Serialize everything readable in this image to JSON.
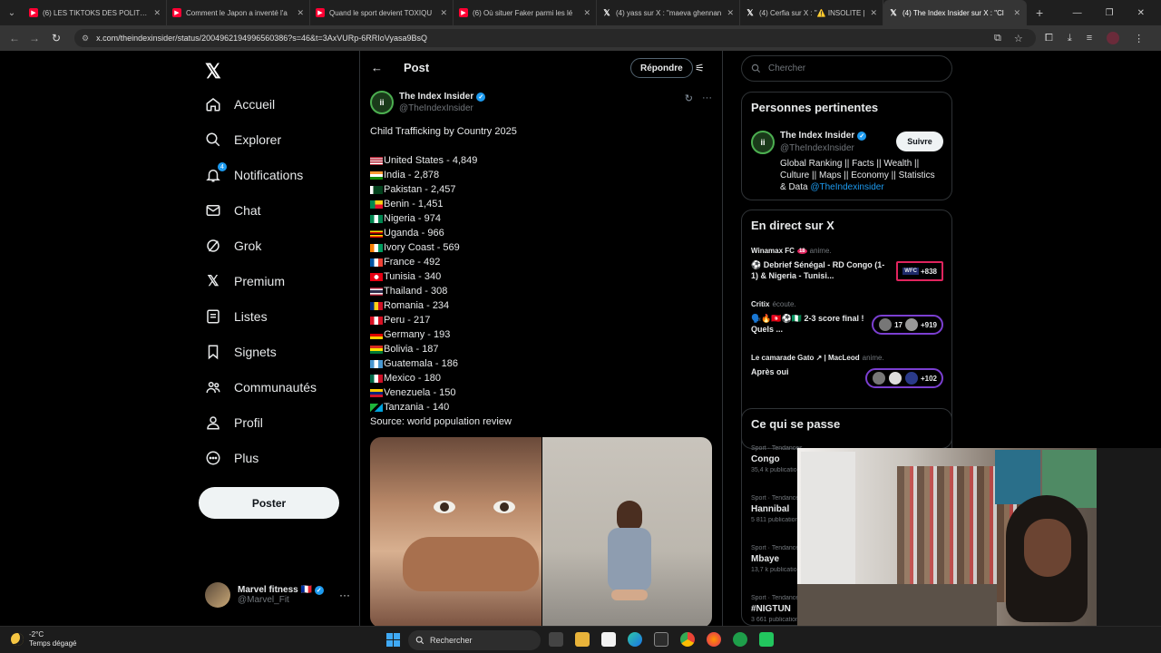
{
  "browser": {
    "tabs": [
      {
        "title": "(6) LES TIKTOKS DES POLITIQUES",
        "icon": "youtube-icon",
        "active": false
      },
      {
        "title": "Comment le Japon a inventé l'a",
        "icon": "youtube-icon",
        "active": false
      },
      {
        "title": "Quand le sport devient TOXIQU",
        "icon": "youtube-icon",
        "active": false
      },
      {
        "title": "(6) Où situer Faker parmi les lé",
        "icon": "youtube-icon",
        "active": false
      },
      {
        "title": "(4) yass sur X : \"maeva ghennan",
        "icon": "x-icon",
        "active": false
      },
      {
        "title": "(4) Cerfia sur X : \"⚠️ INSOLITE |",
        "icon": "x-icon",
        "active": false
      },
      {
        "title": "(4) The Index Insider sur X : \"Cl",
        "icon": "x-icon",
        "active": true
      }
    ],
    "url": "x.com/theindexinsider/status/2004962194996560386?s=46&t=3AxVURp-6RRIoVyasa9BsQ"
  },
  "nav": {
    "items": [
      {
        "label": "Accueil",
        "icon": "home-icon"
      },
      {
        "label": "Explorer",
        "icon": "search-icon"
      },
      {
        "label": "Notifications",
        "icon": "bell-icon",
        "badge": "4"
      },
      {
        "label": "Chat",
        "icon": "mail-icon"
      },
      {
        "label": "Grok",
        "icon": "grok-icon"
      },
      {
        "label": "Premium",
        "icon": "x-premium-icon"
      },
      {
        "label": "Listes",
        "icon": "list-icon"
      },
      {
        "label": "Signets",
        "icon": "bookmark-icon"
      },
      {
        "label": "Communautés",
        "icon": "people-icon"
      },
      {
        "label": "Profil",
        "icon": "person-icon"
      },
      {
        "label": "Plus",
        "icon": "more-circle-icon"
      }
    ],
    "post_button": "Poster",
    "account": {
      "name": "Marvel fitness",
      "handle": "@Marvel_Fit",
      "flag": "🇫🇷"
    }
  },
  "header": {
    "title": "Post",
    "reply_button": "Répondre"
  },
  "tweet": {
    "author_name": "The Index Insider",
    "author_handle": "@TheIndexInsider",
    "title": "Child Trafficking by Country 2025",
    "rows": [
      {
        "country": "United States",
        "value": "4,849",
        "flag": "us"
      },
      {
        "country": "India",
        "value": "2,878",
        "flag": "in"
      },
      {
        "country": "Pakistan",
        "value": "2,457",
        "flag": "pk"
      },
      {
        "country": "Benin",
        "value": "1,451",
        "flag": "bj"
      },
      {
        "country": "Nigeria",
        "value": "974",
        "flag": "ng"
      },
      {
        "country": "Uganda",
        "value": "966",
        "flag": "ug"
      },
      {
        "country": "Ivory Coast",
        "value": "569",
        "flag": "ci"
      },
      {
        "country": "France",
        "value": "492",
        "flag": "fr"
      },
      {
        "country": "Tunisia",
        "value": "340",
        "flag": "tn"
      },
      {
        "country": "Thailand",
        "value": "308",
        "flag": "th"
      },
      {
        "country": "Romania",
        "value": "234",
        "flag": "ro"
      },
      {
        "country": "Peru",
        "value": "217",
        "flag": "pe"
      },
      {
        "country": "Germany",
        "value": "193",
        "flag": "de"
      },
      {
        "country": "Bolivia",
        "value": "187",
        "flag": "bo"
      },
      {
        "country": "Guatemala",
        "value": "186",
        "flag": "gt"
      },
      {
        "country": "Mexico",
        "value": "180",
        "flag": "mx"
      },
      {
        "country": "Venezuela",
        "value": "150",
        "flag": "ve"
      },
      {
        "country": "Tanzania",
        "value": "140",
        "flag": "tz"
      }
    ],
    "source": "Source: world population review"
  },
  "sidebar": {
    "search_placeholder": "Chercher",
    "relevant": {
      "title": "Personnes pertinentes",
      "name": "The Index Insider",
      "handle": "@TheIndexInsider",
      "follow": "Suivre",
      "bio": "Global Ranking || Facts || Wealth || Culture || Maps || Economy || Statistics & Data",
      "bio_link": "@TheIndexinsider"
    },
    "live": {
      "title": "En direct sur X",
      "items": [
        {
          "host": "Winamax FC",
          "extra": "18",
          "action": "anime.",
          "title": "⚽ Debrief Sénégal - RD Congo (1-1) & Nigeria - Tunisi...",
          "count": "+838",
          "pill_label": "WFC"
        },
        {
          "host": "Critix",
          "action": "écoute.",
          "title": "🗣️🔥🇹🇳⚽🇳🇬 2-3 score final ! Quels ...",
          "count": "+919",
          "pill_label": "17"
        },
        {
          "host": "Le camarade Gato ↗ | MacLeod",
          "action": "anime.",
          "title": "Après oui",
          "count": "+102",
          "pill_label": ""
        }
      ]
    },
    "trends": {
      "title": "Ce qui se passe",
      "items": [
        {
          "category": "Sport · Tendances",
          "name": "Congo",
          "count": "35,4 k publications"
        },
        {
          "category": "Sport · Tendances",
          "name": "Hannibal",
          "count": "5 811 publications"
        },
        {
          "category": "Sport · Tendances",
          "name": "Mbaye",
          "count": "13,7 k publications"
        },
        {
          "category": "Sport · Tendances",
          "name": "#NIGTUN",
          "count": "3 661 publications"
        }
      ]
    }
  },
  "taskbar": {
    "temp": "-2°C",
    "weather": "Temps dégagé",
    "search": "Rechercher"
  },
  "colors": {
    "accent": "#1d9bf0",
    "background": "#000000",
    "border": "#2f3336",
    "muted": "#71767b"
  }
}
